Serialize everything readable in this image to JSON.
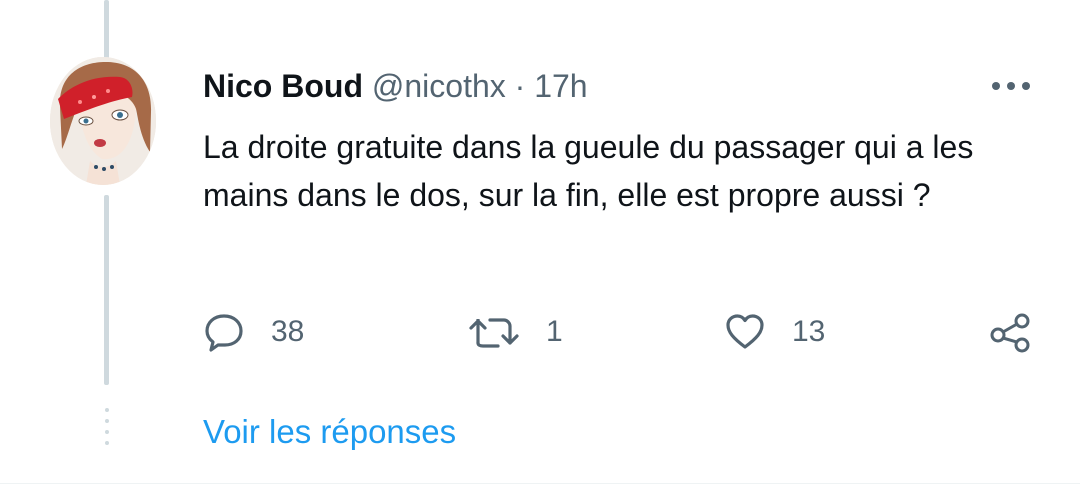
{
  "tweet": {
    "author_name": "Nico Boud",
    "handle": "@nicothx",
    "separator": "·",
    "time": "17h",
    "text": "La droite gratuite dans la gueule du passager qui a les mains dans le dos, sur la fin, elle est propre aussi ?",
    "actions": {
      "reply_count": "38",
      "retweet_count": "1",
      "like_count": "13"
    }
  },
  "show_replies_label": "Voir les réponses",
  "colors": {
    "text": "#0f1419",
    "secondary": "#536471",
    "link": "#1d9bf0",
    "thread_line": "#cfd9de"
  },
  "icons": [
    "more-icon",
    "reply-icon",
    "retweet-icon",
    "like-icon",
    "share-icon"
  ]
}
